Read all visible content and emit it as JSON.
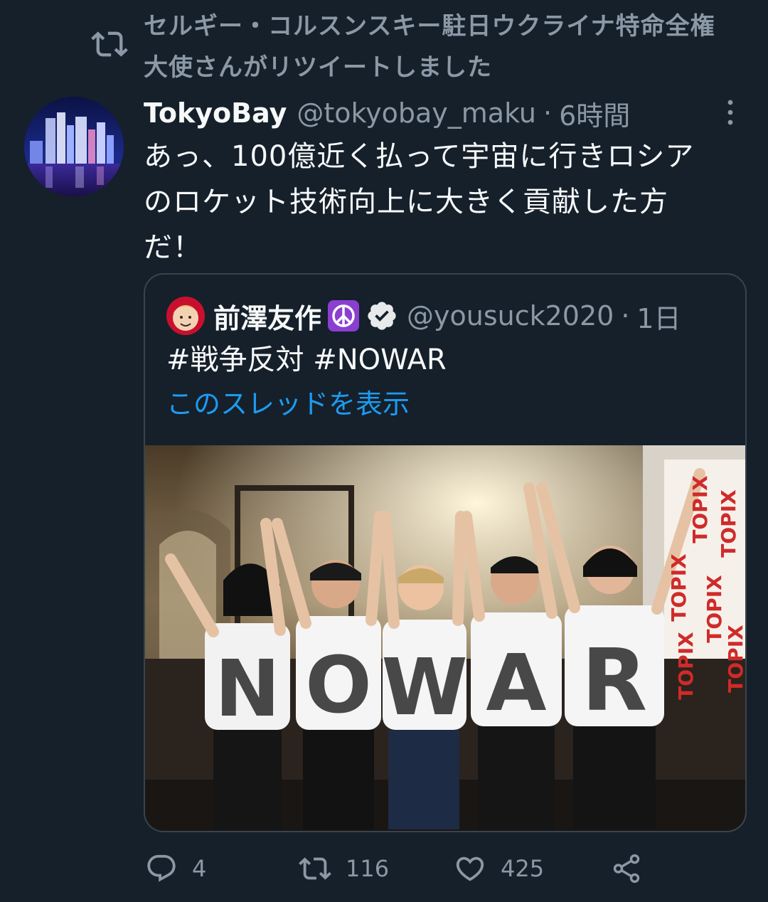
{
  "retweet_banner": {
    "line1": "セルギー・コルスンスキー駐日ウクライナ特命全権",
    "line2": "大使さんがリツイートしました"
  },
  "tweet": {
    "display_name": "TokyoBay",
    "handle": "@tokyobay_maku",
    "separator": "·",
    "time": "6時間",
    "text_lines": [
      "あっ、100億近く払って宇宙に行きロシア",
      "のロケット技術向上に大きく貢献した方",
      "だ！"
    ]
  },
  "quoted_tweet": {
    "display_name": "前澤友作",
    "handle": "@yousuck2020",
    "separator": "·",
    "time": "1日",
    "text": "#戦争反対 #NOWAR",
    "thread_link": "このスレッドを表示",
    "photo_letters": [
      "N",
      "O",
      "W",
      "A",
      "R"
    ],
    "photo_sign_text": [
      "TOPIX",
      "TOPIX",
      "TOPIX",
      "TOPIX",
      "TOPIX",
      "TOPIX"
    ]
  },
  "actions": {
    "replies": "4",
    "retweets": "116",
    "likes": "425"
  },
  "colors": {
    "background": "#15202b",
    "primary_text": "#f7f9f9",
    "secondary_text": "#8b98a5",
    "link": "#1d9bf0",
    "border": "#38444d",
    "peace_badge": "#8b3fd0"
  },
  "icons": {
    "retweet_banner": "retweet-icon",
    "more": "more-vertical-icon",
    "reply": "reply-icon",
    "retweet": "retweet-icon",
    "like": "heart-icon",
    "share": "share-icon",
    "badge": "peace-symbol-icon",
    "verified": "verified-badge-icon"
  }
}
